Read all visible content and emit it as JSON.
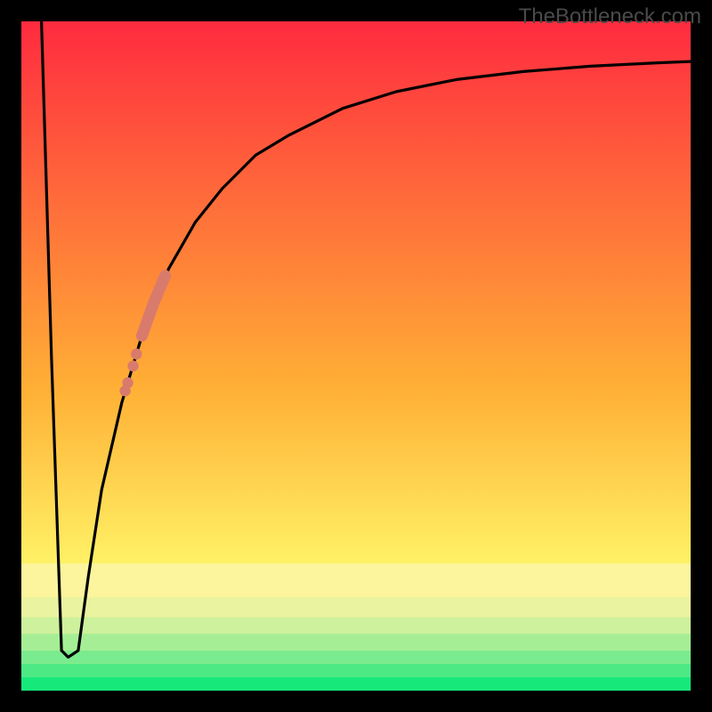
{
  "watermark": "TheBottleneck.com",
  "chart_data": {
    "type": "line",
    "title": "",
    "xlabel": "",
    "ylabel": "",
    "xlim": [
      0,
      100
    ],
    "ylim": [
      0,
      100
    ],
    "curve": {
      "name": "bottleneck-curve",
      "color": "#000000",
      "x": [
        3.0,
        4.5,
        6.0,
        7.0,
        8.5,
        10.0,
        12.0,
        15.0,
        18.0,
        22.0,
        26.0,
        30.0,
        35.0,
        40.0,
        48.0,
        56.0,
        65.0,
        75.0,
        85.0,
        95.0,
        100.0
      ],
      "y": [
        100,
        50,
        6,
        5,
        6,
        17,
        30,
        43,
        53,
        63,
        70,
        75,
        80,
        83,
        87,
        89.5,
        91.3,
        92.5,
        93.3,
        93.8,
        94.0
      ]
    },
    "highlight_segment": {
      "name": "highlight-range",
      "color": "#d97b6c",
      "points": [
        {
          "x": 18.0,
          "y": 53.0
        },
        {
          "x": 19.8,
          "y": 58.0
        },
        {
          "x": 21.5,
          "y": 62.0
        }
      ],
      "dots": [
        {
          "x": 15.5,
          "y": 44.8
        },
        {
          "x": 15.9,
          "y": 46.0
        },
        {
          "x": 16.7,
          "y": 48.5
        },
        {
          "x": 17.2,
          "y": 50.3
        }
      ]
    },
    "bands": [
      {
        "y0": 0,
        "y1": 2,
        "color": "#17e87a"
      },
      {
        "y0": 2,
        "y1": 4,
        "color": "#4ce985"
      },
      {
        "y0": 4,
        "y1": 6,
        "color": "#7aeb8e"
      },
      {
        "y0": 6,
        "y1": 8.5,
        "color": "#a5ee96"
      },
      {
        "y0": 8.5,
        "y1": 11,
        "color": "#cdf19d"
      },
      {
        "y0": 11,
        "y1": 14,
        "color": "#eaf3a0"
      },
      {
        "y0": 14,
        "y1": 19,
        "color": "#fcf59e"
      }
    ],
    "gradient": {
      "top": "#ff2b3f",
      "mid": "#ffb035",
      "bottom": "#fff468"
    }
  }
}
